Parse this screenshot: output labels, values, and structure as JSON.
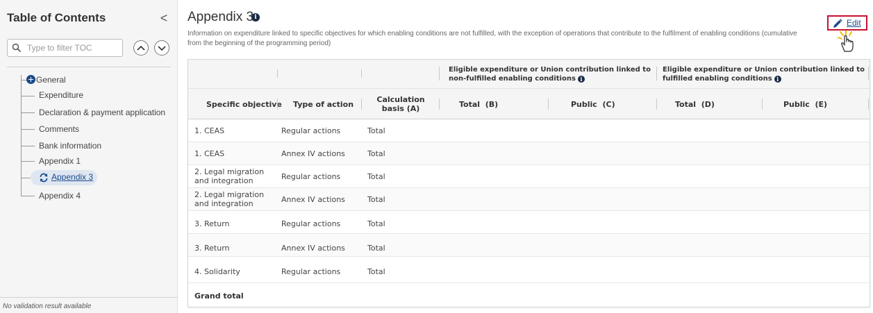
{
  "sidebar": {
    "title": "Table of Contents",
    "collapse_glyph": "<",
    "filter_placeholder": "Type to filter TOC",
    "items": [
      {
        "label": "General"
      },
      {
        "label": "Expenditure"
      },
      {
        "label": "Declaration & payment application"
      },
      {
        "label": "Comments"
      },
      {
        "label": "Bank information"
      },
      {
        "label": "Appendix 1"
      },
      {
        "label": "Appendix 3"
      },
      {
        "label": "Appendix 4"
      }
    ],
    "validation": "No validation result available"
  },
  "page": {
    "title": "Appendix 3",
    "description": "Information on expenditure linked to specific objectives for which enabling conditions are not fulfilled, with the exception of operations that contribute to the fulfilment of enabling conditions (cumulative from the beginning of the programming period)",
    "edit_label": "Edit"
  },
  "table": {
    "group_headers": {
      "non_fulfilled": "Eligible expenditure or Union contribution linked to non-fulfilled enabling conditions",
      "fulfilled": "Eligible expenditure or Union contribution linked to fulfilled enabling conditions"
    },
    "columns": [
      "Specific objective",
      "Type of action",
      "Calculation basis (A)",
      "Total  (B)",
      "Public  (C)",
      "Total  (D)",
      "Public  (E)"
    ],
    "rows": [
      {
        "objective": "1. CEAS",
        "action": "Regular actions",
        "basis": "Total"
      },
      {
        "objective": "1. CEAS",
        "action": "Annex IV actions",
        "basis": "Total"
      },
      {
        "objective": "2. Legal migration and integration",
        "action": "Regular actions",
        "basis": "Total"
      },
      {
        "objective": "2. Legal migration and integration",
        "action": "Annex IV actions",
        "basis": "Total"
      },
      {
        "objective": "3. Return",
        "action": "Regular actions",
        "basis": "Total"
      },
      {
        "objective": "3. Return",
        "action": "Annex IV actions",
        "basis": "Total"
      },
      {
        "objective": "4. Solidarity",
        "action": "Regular actions",
        "basis": "Total"
      }
    ],
    "grand_total": "Grand total"
  }
}
